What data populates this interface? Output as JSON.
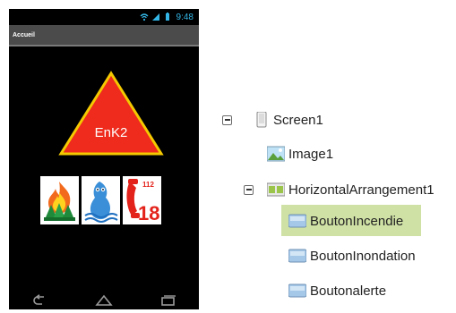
{
  "phone": {
    "status_time": "9:48",
    "title": "Accueil",
    "logo_text": "EnK2",
    "buttons": [
      {
        "name": "BoutonIncendie",
        "icon": "fire-icon"
      },
      {
        "name": "BoutonInondation",
        "icon": "flood-icon"
      },
      {
        "name": "Boutonalerte",
        "icon": "emergency-phone-icon",
        "texts": [
          "112",
          "18"
        ]
      }
    ],
    "nav": [
      "back-icon",
      "home-icon",
      "recent-apps-icon"
    ]
  },
  "tree": {
    "screen": "Screen1",
    "image": "Image1",
    "arrangement": "HorizontalArrangement1",
    "buttons": [
      "BoutonIncendie",
      "BoutonInondation",
      "Boutonalerte"
    ],
    "selected": "BoutonIncendie"
  },
  "colors": {
    "triangle": "#ee2b1c",
    "triangle_border": "#f4c900",
    "status_accent": "#33b5e5",
    "selection": "#cfe1a5"
  }
}
